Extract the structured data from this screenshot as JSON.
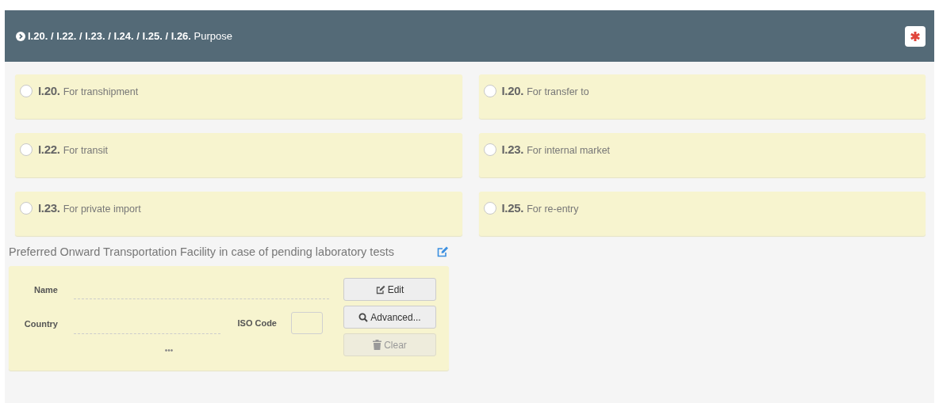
{
  "section": {
    "title": "**I.20. / I.22. / I.23. / I.24. / I.25. / I.26.** Purpose",
    "required": true
  },
  "options": [
    {
      "code": "I.20.",
      "label": "For transhipment",
      "selected": false
    },
    {
      "code": "I.20.",
      "label": "For transfer to",
      "selected": false
    },
    {
      "code": "I.22.",
      "label": "For transit",
      "selected": false
    },
    {
      "code": "I.23.",
      "label": "For internal market",
      "selected": false
    },
    {
      "code": "I.23.",
      "label": "For private import",
      "selected": false
    },
    {
      "code": "I.25.",
      "label": "For re-entry",
      "selected": false
    }
  ],
  "facility": {
    "title": "Preferred Onward Transportation Facility in case of pending laboratory tests",
    "name_label": "Name",
    "country_label": "Country",
    "iso_label": "ISO Code",
    "more": "•••",
    "buttons": [
      {
        "kind": "edit",
        "label": "Edit",
        "disabled": false
      },
      {
        "kind": "search",
        "label": "Advanced...",
        "disabled": false
      },
      {
        "kind": "trash",
        "label": "Clear",
        "disabled": true
      }
    ]
  }
}
